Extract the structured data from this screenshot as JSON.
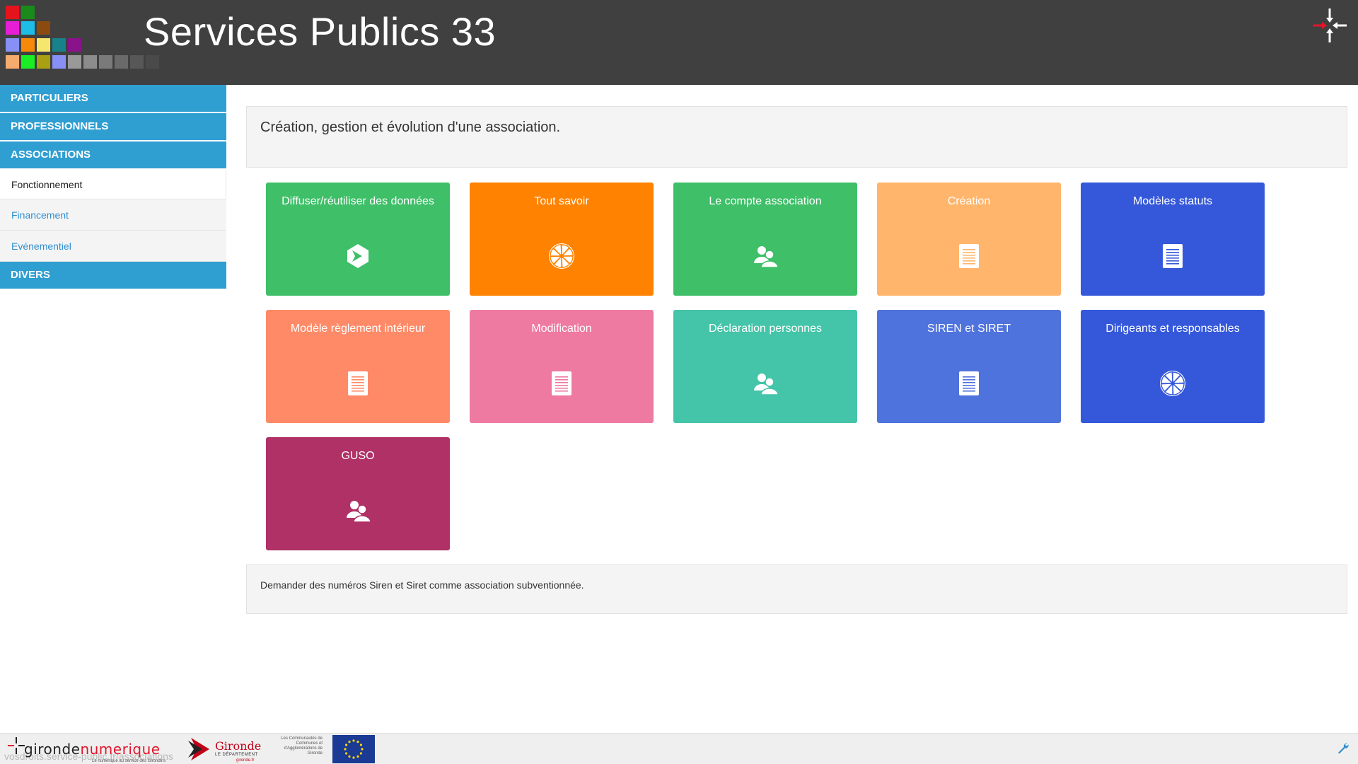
{
  "header": {
    "title": "Services Publics 33",
    "palette_colors": [
      "#e5141c",
      "#1a8a1a",
      "#e61ed5",
      "#1ebde8",
      "#8a4a10",
      "#8890f5",
      "#f58a0a",
      "#f5e66e",
      "#17828a",
      "#8a128a",
      "#f5aa6e",
      "#1aef24",
      "#a8a012",
      "#8890f5",
      "#999999",
      "#8c8c8c",
      "#7a7a7a",
      "#6a6a6a",
      "#575757",
      "#4a4a4a"
    ],
    "logo_icon": "gironde-numerique-arrows-icon"
  },
  "sidebar": {
    "categories": [
      {
        "label": "PARTICULIERS"
      },
      {
        "label": "PROFESSIONNELS"
      },
      {
        "label": "ASSOCIATIONS"
      },
      {
        "label": "DIVERS"
      }
    ],
    "sub_items": [
      {
        "label": "Fonctionnement",
        "active": true
      },
      {
        "label": "Financement",
        "active": false
      },
      {
        "label": "Evénementiel",
        "active": false
      }
    ],
    "accent_color": "#2f9ed1"
  },
  "intro": {
    "text": "Création, gestion et évolution d'une association."
  },
  "tiles": [
    {
      "label": "Diffuser/réutiliser des données",
      "color": "#3ebf68",
      "icon": "data-share-icon"
    },
    {
      "label": "Tout savoir",
      "color": "#ff8200",
      "icon": "aperture-icon"
    },
    {
      "label": "Le compte association",
      "color": "#3ebf68",
      "icon": "users-icon"
    },
    {
      "label": "Création",
      "color": "#ffb56b",
      "icon": "document-icon"
    },
    {
      "label": "Modèles statuts",
      "color": "#3558da",
      "icon": "document-icon"
    },
    {
      "label": "Modèle règlement intérieur",
      "color": "#ff8a68",
      "icon": "document-icon"
    },
    {
      "label": "Modification",
      "color": "#ee7aa1",
      "icon": "document-icon"
    },
    {
      "label": "Déclaration personnes",
      "color": "#44c4a8",
      "icon": "users-icon"
    },
    {
      "label": "SIREN et SIRET",
      "color": "#4f73dd",
      "icon": "document-icon"
    },
    {
      "label": "Dirigeants et responsables",
      "color": "#3558da",
      "icon": "aperture-icon"
    },
    {
      "label": "GUSO",
      "color": "#b03166",
      "icon": "users-icon"
    }
  ],
  "description": {
    "text": "Demander des numéros Siren et Siret comme association subventionnée."
  },
  "footer": {
    "gironde_numerique_a": "gironde",
    "gironde_numerique_b": "numerique",
    "gironde_numerique_tag": "Le numérique au service des Girondins",
    "gironde_name": "Gironde",
    "gironde_sub": "LE DÉPARTEMENT",
    "gironde_url": "gironde.fr",
    "communautes_text": "Les Communautés de Communes et d'Agglomérations de Gironde",
    "url_text": "vosdroits.service-public.fr/associations",
    "settings_icon": "wrench-icon"
  }
}
